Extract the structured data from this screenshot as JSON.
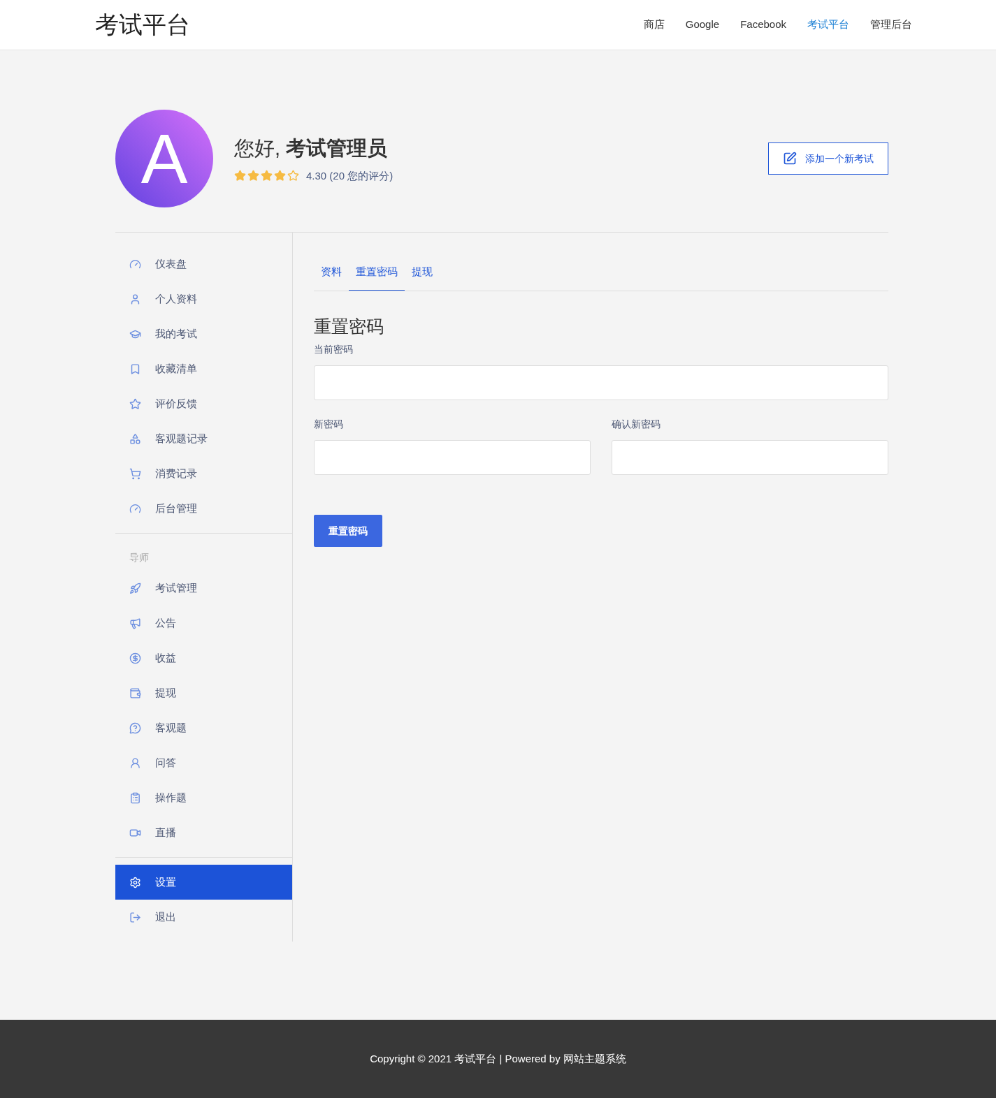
{
  "header": {
    "logo": "考试平台",
    "nav": [
      {
        "label": "商店",
        "selected": false
      },
      {
        "label": "Google",
        "selected": false
      },
      {
        "label": "Facebook",
        "selected": false
      },
      {
        "label": "考试平台",
        "selected": true
      },
      {
        "label": "管理后台",
        "selected": false
      }
    ]
  },
  "profile": {
    "avatar_letter": "A",
    "greeting": "您好,",
    "name": "考试管理员",
    "stars": 4,
    "rating": "4.30 (20 您的评分)",
    "action": "添加一个新考试"
  },
  "sidebar": {
    "sections": [
      {
        "items": [
          {
            "label": "仪表盘",
            "selected": false
          },
          {
            "label": "个人资料",
            "selected": false
          },
          {
            "label": "我的考试",
            "selected": false
          },
          {
            "label": "收藏清单",
            "selected": false
          },
          {
            "label": "评价反馈",
            "selected": false
          },
          {
            "label": "客观题记录",
            "selected": false
          },
          {
            "label": "消费记录",
            "selected": false
          },
          {
            "label": "后台管理",
            "selected": false
          }
        ]
      },
      {
        "heading": "导师",
        "items": [
          {
            "label": "考试管理",
            "selected": false
          },
          {
            "label": "公告",
            "selected": false
          },
          {
            "label": "收益",
            "selected": false
          },
          {
            "label": "提现",
            "selected": false
          },
          {
            "label": "客观题",
            "selected": false
          },
          {
            "label": "问答",
            "selected": false
          },
          {
            "label": "操作题",
            "selected": false
          },
          {
            "label": "直播",
            "selected": false
          }
        ]
      },
      {
        "items": [
          {
            "label": "设置",
            "selected": true
          },
          {
            "label": "退出",
            "selected": false
          }
        ]
      }
    ]
  },
  "tabs": [
    {
      "label": "资料",
      "selected": false
    },
    {
      "label": "重置密码",
      "selected": true
    },
    {
      "label": "提现",
      "selected": false
    }
  ],
  "form": {
    "title": "重置密码",
    "fields": [
      {
        "label": "当前密码"
      },
      {
        "label": "新密码"
      },
      {
        "label": "确认新密码"
      }
    ],
    "submit": "重置密码"
  },
  "footer": {
    "text": "Copyright © 2021 考试平台 | Powered by 网站主题系统"
  }
}
